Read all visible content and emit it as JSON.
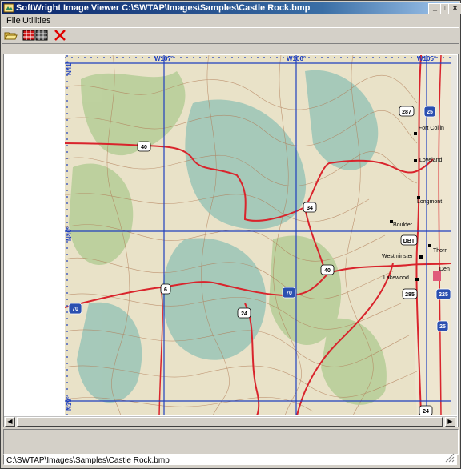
{
  "window": {
    "title": "SoftWright Image Viewer C:\\SWTAP\\Images\\Samples\\Castle Rock.bmp"
  },
  "title_buttons": [
    "_",
    "□",
    "×"
  ],
  "menu": [
    "File",
    "Utilities"
  ],
  "toolbar": [
    {
      "name": "open-folder-icon"
    },
    {
      "name": "grid-icon"
    },
    {
      "name": "grid-icon"
    },
    {
      "name": "close-icon",
      "color": "#e00000"
    }
  ],
  "map": {
    "longitude_labels": [
      "W107°",
      "W106°",
      "W105°"
    ],
    "latitude_labels": [
      "N41°",
      "N40°",
      "N39°"
    ],
    "route_shields": [
      "287",
      "25",
      "40",
      "34",
      "40",
      "6",
      "24",
      "70",
      "285",
      "225",
      "25",
      "24",
      "70",
      "DBT"
    ],
    "place_labels": [
      "Fort Collin",
      "Loveland",
      "Longmont",
      "Boulder",
      "Westminster",
      "Thorn",
      "Lakewood",
      "Den"
    ],
    "colors": {
      "terrain": "#e9e2c8",
      "forest": "#b9cf9a",
      "shade": "#9fc7b8",
      "contour": "#b07a55",
      "highway": "#d9242c",
      "grid": "#1f3fbf"
    }
  },
  "statusbar": {
    "path": "C:\\SWTAP\\Images\\Samples\\Castle Rock.bmp"
  }
}
